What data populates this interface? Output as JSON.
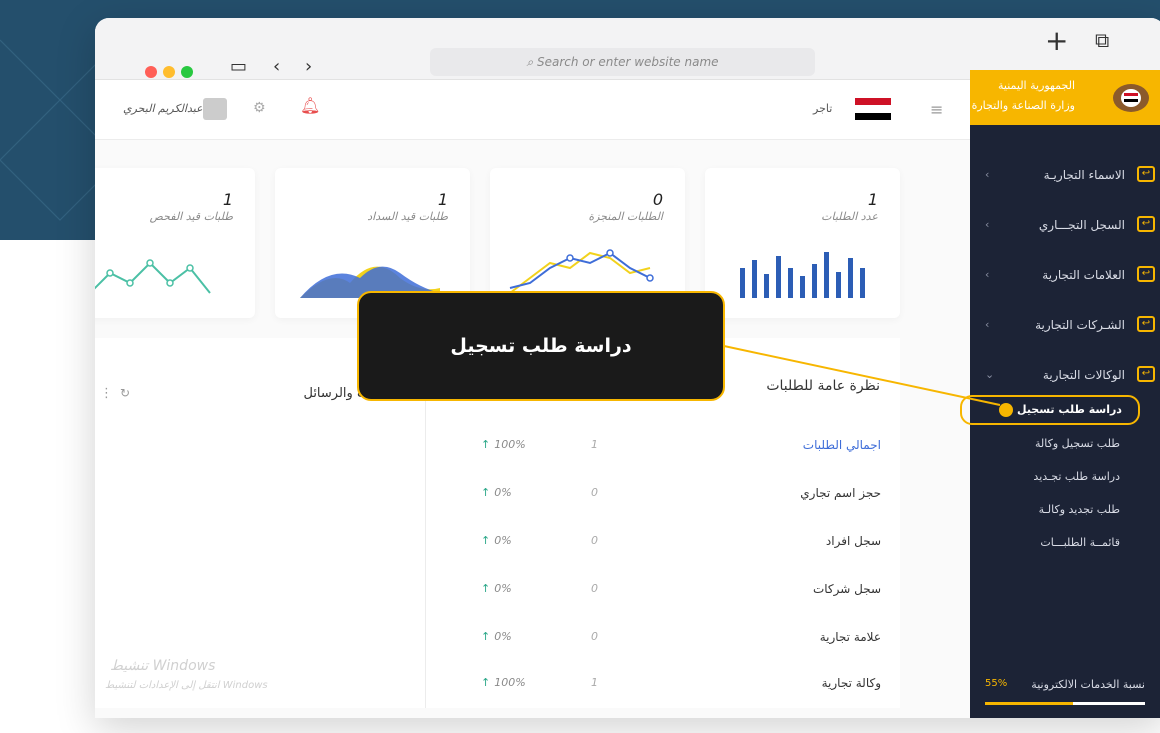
{
  "browser": {
    "address_placeholder": "Search or enter website name",
    "icons": [
      "sidebar-toggle-icon",
      "back-icon",
      "forward-icon",
      "new-tab-icon",
      "tabs-overview-icon"
    ]
  },
  "topbar": {
    "user_name": "عبدالكريم البحري",
    "role": "تاجر",
    "icons": [
      "avatar",
      "gear-icon",
      "bell-icon",
      "hamburger-icon",
      "flag-icon"
    ]
  },
  "brand": {
    "line1": "الجمهورية اليمنية",
    "line2": "وزارة الصناعة والتجارة"
  },
  "sidebar": {
    "items": [
      {
        "label": "الاسماء التجاريـة"
      },
      {
        "label": "السجل التجـــاري"
      },
      {
        "label": "العلامات التجارية"
      },
      {
        "label": "الشـركات التجارية"
      },
      {
        "label": "الوكالات التجارية"
      }
    ],
    "sub_items": [
      {
        "label": "دراسة طلب تسجيل",
        "active": true
      },
      {
        "label": "طلب تسجيل وكالة"
      },
      {
        "label": "دراسة طلب تجـديد"
      },
      {
        "label": "طلب تجديد وكالـة"
      },
      {
        "label": "قائمــة الطلبـــات"
      }
    ],
    "progress": {
      "label": "نسبة الخدمات الالكترونية",
      "percent_text": "55%",
      "value": 0.55
    },
    "accent": "#f7b600",
    "bg": "#1c2336"
  },
  "stats": [
    {
      "title": "عدد الطلبات",
      "value": "1"
    },
    {
      "title": "الطلبات المنجزة",
      "value": "0"
    },
    {
      "title": "طلبات قيد السداد",
      "value": "1"
    },
    {
      "title": "طلبات قيد الفحص",
      "value": "1"
    }
  ],
  "overview": {
    "title": "نظرة عامة للطلبات",
    "rows": [
      {
        "name": "اجمالي الطلبات",
        "count": "1",
        "pct": "100%"
      },
      {
        "name": "حجز اسم تجاري",
        "count": "0",
        "pct": "0%"
      },
      {
        "name": "سجل افراد",
        "count": "0",
        "pct": "0%"
      },
      {
        "name": "سجل شركات",
        "count": "0",
        "pct": "0%"
      },
      {
        "name": "علامة تجارية",
        "count": "0",
        "pct": "0%"
      },
      {
        "name": "وكالة تجارية",
        "count": "1",
        "pct": "100%"
      }
    ]
  },
  "messages_panel": {
    "title": "هات والرسائل"
  },
  "callout": {
    "text": "دراسة طلب تسجيل"
  },
  "watermark": {
    "line1": "تنشيط Windows",
    "line2": "انتقل إلى الإعدادات لتنشيط Windows"
  }
}
